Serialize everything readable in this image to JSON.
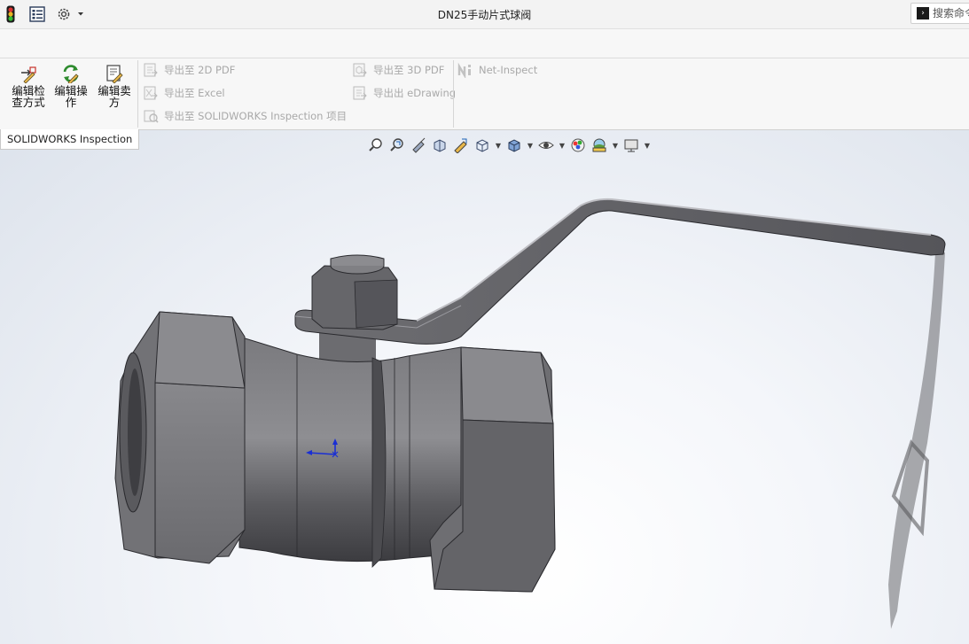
{
  "window": {
    "title": "DN25手动片式球阀"
  },
  "search": {
    "placeholder": "搜索命令"
  },
  "ribbon": {
    "buttons": [
      {
        "label": "编辑检\n查方式"
      },
      {
        "label": "编辑操\n作"
      },
      {
        "label": "编辑卖\n方"
      }
    ],
    "export_items": [
      {
        "label": "导出至 2D PDF"
      },
      {
        "label": "导出至 Excel"
      },
      {
        "label": "导出至 SOLIDWORKS Inspection 项目"
      },
      {
        "label": "导出至 3D PDF"
      },
      {
        "label": "导出出 eDrawing"
      },
      {
        "label": "Net-Inspect"
      }
    ]
  },
  "tabs": {
    "active": "SOLIDWORKS Inspection"
  },
  "colors": {
    "accent_red": "#c8312a",
    "icon_green": "#2e8b2e",
    "triad_blue": "#1a2fd4"
  }
}
